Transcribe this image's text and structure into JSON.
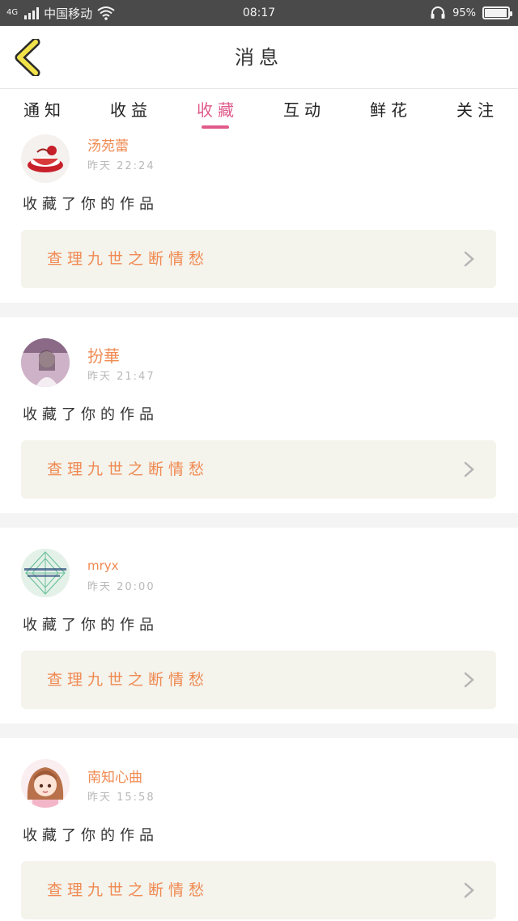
{
  "status_bar": {
    "network": "4G",
    "carrier": "中国移动",
    "time": "08:17",
    "battery_text": "95%",
    "battery_level": 0.95
  },
  "header": {
    "title": "消息",
    "back_icon": "chevron-left-icon"
  },
  "tabs": [
    {
      "label": "通知",
      "active": false
    },
    {
      "label": "收益",
      "active": false
    },
    {
      "label": "收藏",
      "active": true
    },
    {
      "label": "互动",
      "active": false
    },
    {
      "label": "鲜花",
      "active": false
    },
    {
      "label": "关注",
      "active": false
    }
  ],
  "messages": [
    {
      "username": "汤苑蕾",
      "time": "昨天 22:24",
      "action": "收藏了你的作品",
      "work_title": "查理九世之断情愁"
    },
    {
      "username": "扮華",
      "time": "昨天 21:47",
      "action": "收藏了你的作品",
      "work_title": "查理九世之断情愁"
    },
    {
      "username": "mryx",
      "time": "昨天 20:00",
      "action": "收藏了你的作品",
      "work_title": "查理九世之断情愁"
    },
    {
      "username": "南知心曲",
      "time": "昨天 15:58",
      "action": "收藏了你的作品",
      "work_title": "查理九世之断情愁"
    }
  ],
  "colors": {
    "accent": "#e05a8a",
    "username": "#f08a52",
    "work_bg": "#f4f3ec",
    "back_icon_fill": "#f2e24a"
  }
}
